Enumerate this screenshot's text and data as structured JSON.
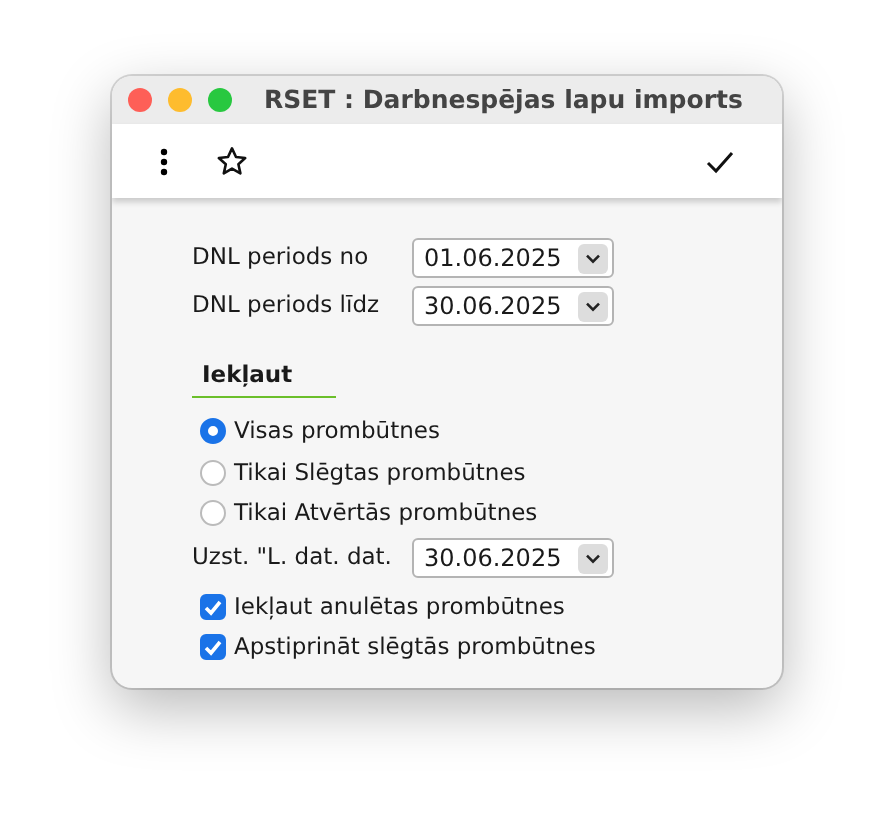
{
  "window": {
    "title": "RSET : Darbnespējas lapu imports"
  },
  "fields": [
    {
      "label": "DNL periods no",
      "value": "01.06.2025"
    },
    {
      "label": "DNL periods līdz",
      "value": "30.06.2025"
    }
  ],
  "include": {
    "heading": "Iekļaut",
    "options": [
      {
        "label": "Visas prombūtnes",
        "selected": true
      },
      {
        "label": "Tikai Slēgtas prombūtnes",
        "selected": false
      },
      {
        "label": "Tikai Atvērtās prombūtnes",
        "selected": false
      }
    ]
  },
  "close_date": {
    "label": "Uzst. \"L. dat. dat.",
    "value": "30.06.2025"
  },
  "checkboxes": [
    {
      "label": "Iekļaut anulētas prombūtnes",
      "checked": true
    },
    {
      "label": "Apstiprināt slēgtās prombūtnes",
      "checked": true
    }
  ]
}
